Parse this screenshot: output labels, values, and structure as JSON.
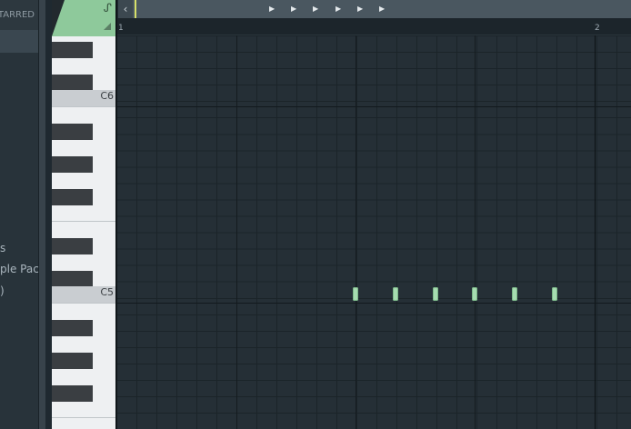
{
  "browser": {
    "header_label": "TARRED",
    "items": [
      "s",
      "ple Pack",
      ")"
    ]
  },
  "corner": {
    "tool_icon": "stamp-icon",
    "tool_glyph": "ᔑ"
  },
  "topbar": {
    "left_glyph": "‹",
    "play_glyph": "▶"
  },
  "ruler": {
    "bars": [
      "1",
      "2"
    ]
  },
  "keyboard": {
    "octave_labels": [
      "C6",
      "C5"
    ]
  },
  "notes": {
    "count": 6,
    "pitch": "C5",
    "color": "#a6dcb0"
  },
  "colors": {
    "accent": "#8ec99b",
    "playhead": "#d7e06a"
  }
}
